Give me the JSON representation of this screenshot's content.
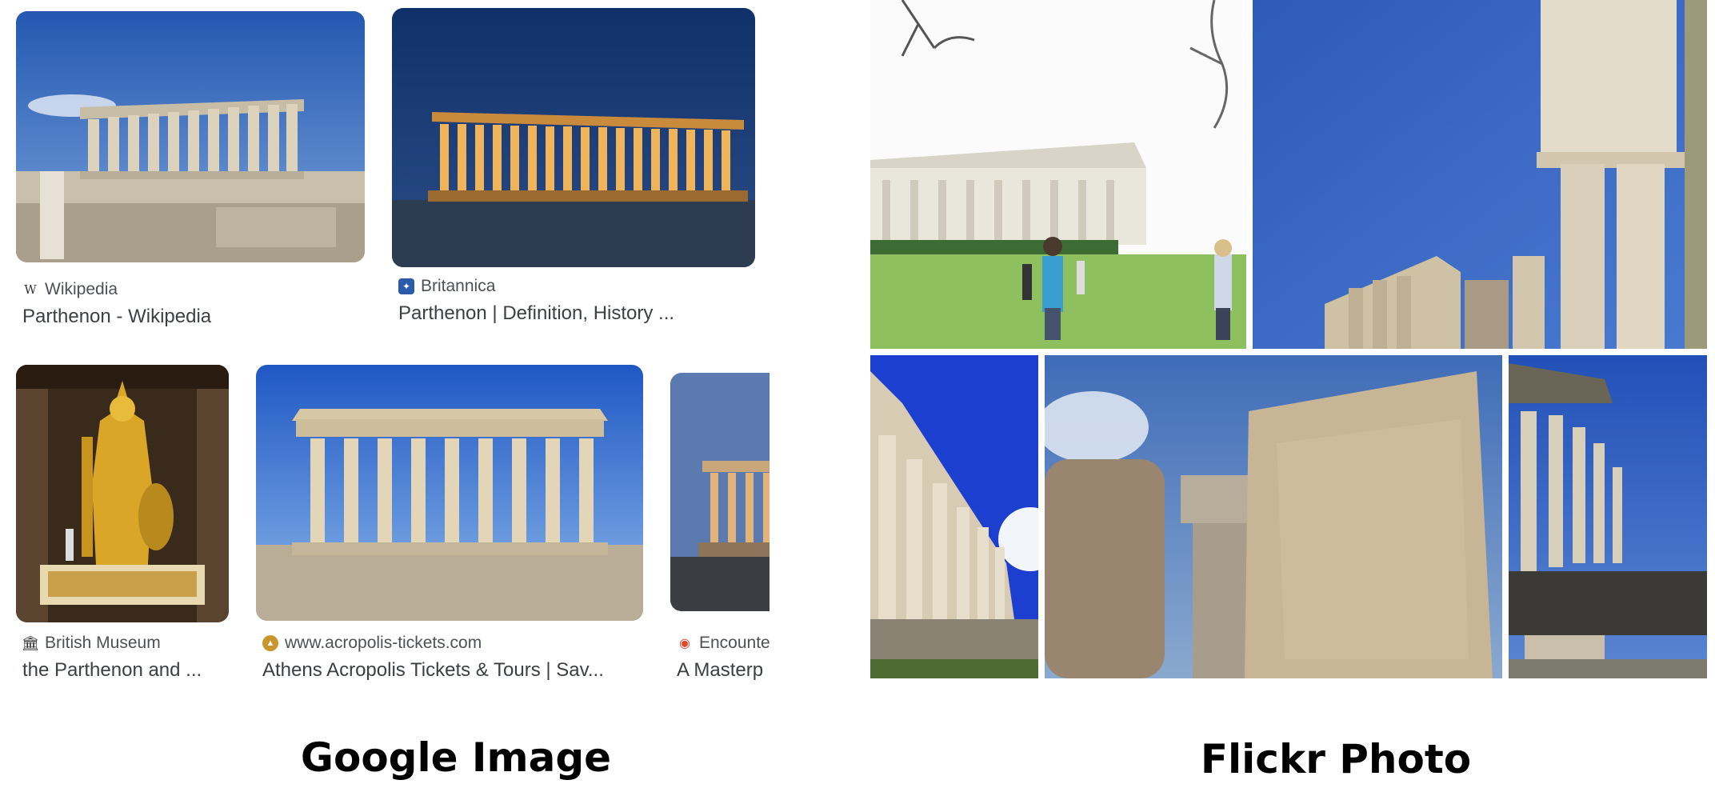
{
  "google_panel": {
    "caption": "Google Image",
    "results": [
      {
        "source": "Wikipedia",
        "title": "Parthenon - Wikipedia",
        "favicon": "wikipedia-w-icon"
      },
      {
        "source": "Britannica",
        "title": "Parthenon | Definition, History ...",
        "favicon": "britannica-icon"
      },
      {
        "source": "British Museum",
        "title": "the Parthenon and ...",
        "favicon": "museum-building-icon"
      },
      {
        "source": "www.acropolis-tickets.com",
        "title": "Athens Acropolis Tickets & Tours | Sav...",
        "favicon": "acropolis-tickets-icon"
      },
      {
        "source": "Encounte",
        "title": "A Masterp",
        "favicon": "encounter-swirl-icon"
      }
    ]
  },
  "flickr_panel": {
    "caption": "Flickr Photo",
    "photos": [
      "parthenon-replica-lawn",
      "column-capitals-blue-sky",
      "colonnade-angle-view",
      "stone-closeup-blur",
      "temple-corner-view"
    ]
  },
  "colors": {
    "sky_blue": "#2a56b8",
    "night_sky": "#1d3b72",
    "marble": "#d8cbb1",
    "lit_marble": "#e8a84a",
    "grass": "#8fc060"
  }
}
